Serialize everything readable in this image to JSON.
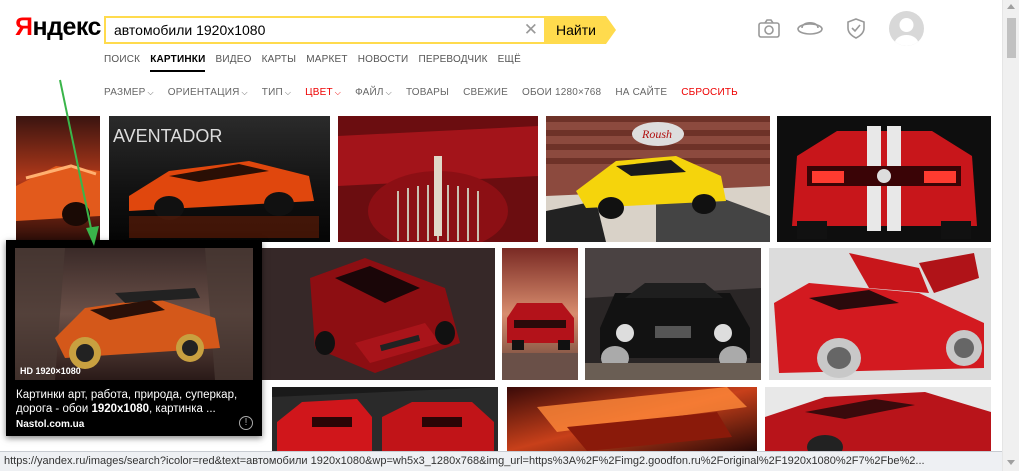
{
  "logo": {
    "first_letter": "Я",
    "rest": "ндекс"
  },
  "search": {
    "value": "автомобили 1920x1080",
    "button_label": "Найти"
  },
  "tabs": [
    {
      "label": "ПОИСК"
    },
    {
      "label": "КАРТИНКИ",
      "active": true
    },
    {
      "label": "ВИДЕО"
    },
    {
      "label": "КАРТЫ"
    },
    {
      "label": "МАРКЕТ"
    },
    {
      "label": "НОВОСТИ"
    },
    {
      "label": "ПЕРЕВОДЧИК"
    },
    {
      "label": "ЕЩЁ"
    }
  ],
  "filters": {
    "size": "РАЗМЕР",
    "orientation": "ОРИЕНТАЦИЯ",
    "type": "ТИП",
    "color": "ЦВЕТ",
    "file": "ФАЙЛ",
    "goods": "ТОВАРЫ",
    "fresh": "СВЕЖИЕ",
    "wallpapers": "ОБОИ 1280×768",
    "on_site": "НА САЙТЕ",
    "reset": "СБРОСИТЬ"
  },
  "header_icons": [
    "camera-icon",
    "disk-icon",
    "shield-icon"
  ],
  "images": [
    {
      "name": "car-image-1"
    },
    {
      "name": "car-image-2",
      "caption": "AVENTADOR"
    },
    {
      "name": "car-image-3"
    },
    {
      "name": "car-image-4",
      "caption": "Roush"
    },
    {
      "name": "car-image-5"
    },
    {
      "name": "car-image-6"
    },
    {
      "name": "car-image-7"
    },
    {
      "name": "car-image-8"
    },
    {
      "name": "car-image-9"
    },
    {
      "name": "car-image-10"
    },
    {
      "name": "car-image-11"
    },
    {
      "name": "car-image-12"
    },
    {
      "name": "car-image-13"
    }
  ],
  "hover_card": {
    "badge": "HD 1920×1080",
    "title_part1": "Картинки арт, работа, природа, суперкар, дорога - обои ",
    "title_bold": "1920x1080",
    "title_part2": ", картинка ...",
    "site": "Nastol.com.ua",
    "info": "!"
  },
  "status_url": "https://yandex.ru/images/search?icolor=red&text=автомобили 1920x1080&wp=wh5x3_1280x768&img_url=https%3A%2F%2Fimg2.goodfon.ru%2Foriginal%2F1920x1080%2F7%2Fbe%2..."
}
